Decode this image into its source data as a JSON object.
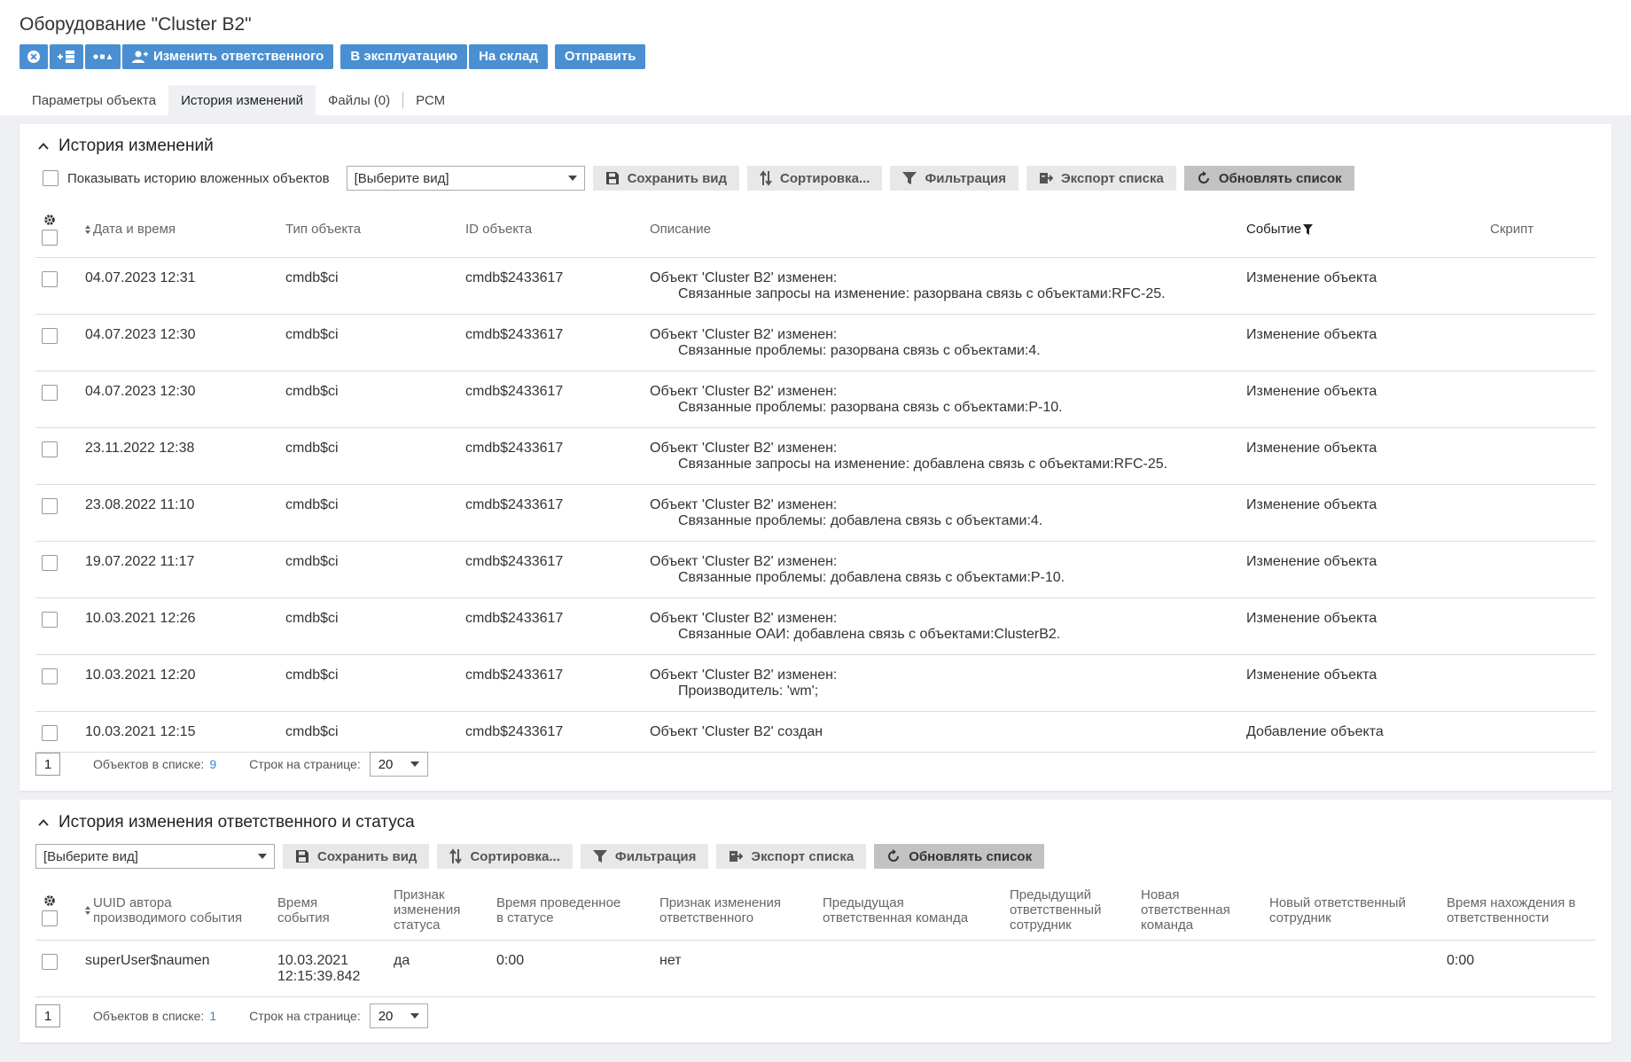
{
  "page": {
    "title": "Оборудование \"Cluster B2\""
  },
  "actions": {
    "change_responsible": "Изменить ответственного",
    "to_operation": "В эксплуатацию",
    "to_warehouse": "На склад",
    "send": "Отправить"
  },
  "tabs": [
    {
      "label": "Параметры объекта"
    },
    {
      "label": "История изменений"
    },
    {
      "label": "Файлы (0)"
    },
    {
      "label": "РСМ"
    }
  ],
  "history": {
    "title": "История изменений",
    "show_nested_label": "Показывать историю вложенных объектов",
    "view_select": "[Выберите вид]",
    "toolbar": {
      "save_view": "Сохранить вид",
      "sort": "Сортировка...",
      "filter": "Фильтрация",
      "export": "Экспорт списка",
      "refresh": "Обновлять список"
    },
    "columns": {
      "date": "Дата и время",
      "type": "Тип объекта",
      "id": "ID объекта",
      "desc": "Описание",
      "event": "Событие",
      "script": "Скрипт"
    },
    "rows": [
      {
        "date": "04.07.2023 12:31",
        "type": "cmdb$ci",
        "id": "cmdb$2433617",
        "line1": "Объект 'Cluster B2' изменен:",
        "line2": "Связанные запросы на изменение: разорвана связь с объектами:RFC-25.",
        "event": "Изменение объекта"
      },
      {
        "date": "04.07.2023 12:30",
        "type": "cmdb$ci",
        "id": "cmdb$2433617",
        "line1": "Объект 'Cluster B2' изменен:",
        "line2": "Связанные проблемы: разорвана связь с объектами:4.",
        "event": "Изменение объекта"
      },
      {
        "date": "04.07.2023 12:30",
        "type": "cmdb$ci",
        "id": "cmdb$2433617",
        "line1": "Объект 'Cluster B2' изменен:",
        "line2": "Связанные проблемы: разорвана связь с объектами:P-10.",
        "event": "Изменение объекта"
      },
      {
        "date": "23.11.2022 12:38",
        "type": "cmdb$ci",
        "id": "cmdb$2433617",
        "line1": "Объект 'Cluster B2' изменен:",
        "line2": "Связанные запросы на изменение: добавлена связь с объектами:RFC-25.",
        "event": "Изменение объекта"
      },
      {
        "date": "23.08.2022 11:10",
        "type": "cmdb$ci",
        "id": "cmdb$2433617",
        "line1": "Объект 'Cluster B2' изменен:",
        "line2": "Связанные проблемы: добавлена связь с объектами:4.",
        "event": "Изменение объекта"
      },
      {
        "date": "19.07.2022 11:17",
        "type": "cmdb$ci",
        "id": "cmdb$2433617",
        "line1": "Объект 'Cluster B2' изменен:",
        "line2": "Связанные проблемы: добавлена связь с объектами:P-10.",
        "event": "Изменение объекта"
      },
      {
        "date": "10.03.2021 12:26",
        "type": "cmdb$ci",
        "id": "cmdb$2433617",
        "line1": "Объект 'Cluster B2' изменен:",
        "line2": "Связанные ОАИ: добавлена связь с объектами:ClusterB2.",
        "event": "Изменение объекта"
      },
      {
        "date": "10.03.2021 12:20",
        "type": "cmdb$ci",
        "id": "cmdb$2433617",
        "line1": "Объект 'Cluster B2' изменен:",
        "line2": "Производитель: 'wm';",
        "event": "Изменение объекта"
      },
      {
        "date": "10.03.2021 12:15",
        "type": "cmdb$ci",
        "id": "cmdb$2433617",
        "line1": "Объект 'Cluster B2' создан",
        "line2": "",
        "event": "Добавление объекта"
      }
    ],
    "footer": {
      "page": "1",
      "count_label": "Объектов в списке:",
      "count": "9",
      "rows_label": "Строк на странице:",
      "rows_value": "20"
    }
  },
  "status_history": {
    "title": "История изменения ответственного и статуса",
    "view_select": "[Выберите вид]",
    "toolbar": {
      "save_view": "Сохранить вид",
      "sort": "Сортировка...",
      "filter": "Фильтрация",
      "export": "Экспорт списка",
      "refresh": "Обновлять список"
    },
    "columns": {
      "author_l1": "UUID автора",
      "author_l2": "производимого события",
      "time_l1": "Время",
      "time_l2": "события",
      "status_l1": "Признак",
      "status_l2": "изменения",
      "status_l3": "статуса",
      "in_status_l1": "Время проведенное",
      "in_status_l2": "в статусе",
      "resp_change_l1": "Признак изменения",
      "resp_change_l2": "ответственного",
      "prev_team_l1": "Предыдущая",
      "prev_team_l2": "ответственная команда",
      "prev_emp_l1": "Предыдущий",
      "prev_emp_l2": "ответственный",
      "prev_emp_l3": "сотрудник",
      "new_team_l1": "Новая",
      "new_team_l2": "ответственная",
      "new_team_l3": "команда",
      "new_emp_l1": "Новый ответственный",
      "new_emp_l2": "сотрудник",
      "resp_time_l1": "Время нахождения в",
      "resp_time_l2": "ответственности"
    },
    "rows": [
      {
        "author": "superUser$naumen",
        "time_l1": "10.03.2021",
        "time_l2": "12:15:39.842",
        "status": "да",
        "in_status": "0:00",
        "resp_change": "нет",
        "prev_team": "",
        "prev_emp": "",
        "new_team": "",
        "new_emp": "",
        "resp_time": "0:00"
      }
    ],
    "footer": {
      "page": "1",
      "count_label": "Объектов в списке:",
      "count": "1",
      "rows_label": "Строк на странице:",
      "rows_value": "20"
    }
  },
  "colors": {
    "primary": "#4a8fd1",
    "link": "#3a85c8",
    "page_bg": "#eef0f3"
  }
}
